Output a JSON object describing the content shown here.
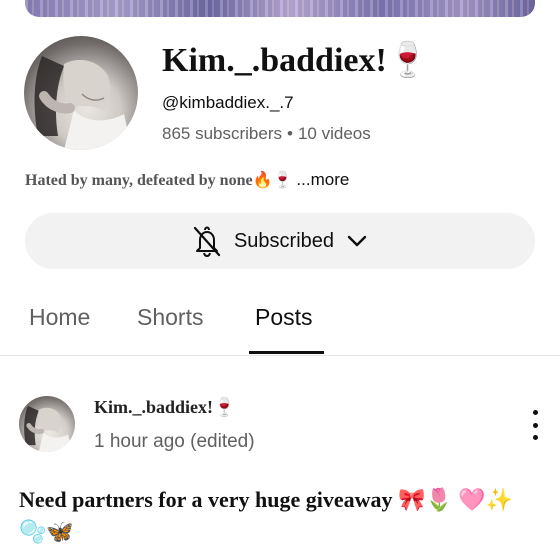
{
  "channel": {
    "name": "Kim._.baddiex!🍷",
    "handle": "@kimbaddiex._.7",
    "subscribers": "865 subscribers",
    "separator": "•",
    "videos": "10 videos",
    "description": "Hated by many, defeated by none🔥🍷",
    "more_label": "...more"
  },
  "subscribe_button": {
    "label": "Subscribed",
    "icon": "bell-off-icon",
    "dropdown_icon": "chevron-down-icon"
  },
  "tabs": [
    {
      "label": "Home",
      "active": false
    },
    {
      "label": "Shorts",
      "active": false
    },
    {
      "label": "Posts",
      "active": true
    }
  ],
  "post": {
    "author": "Kim._.baddiex!🍷",
    "time": "1 hour ago (edited)",
    "text": "Need partners for a very huge giveaway 🎀🌷 🩷✨🫧🦋",
    "menu_icon": "more-vertical-icon"
  }
}
